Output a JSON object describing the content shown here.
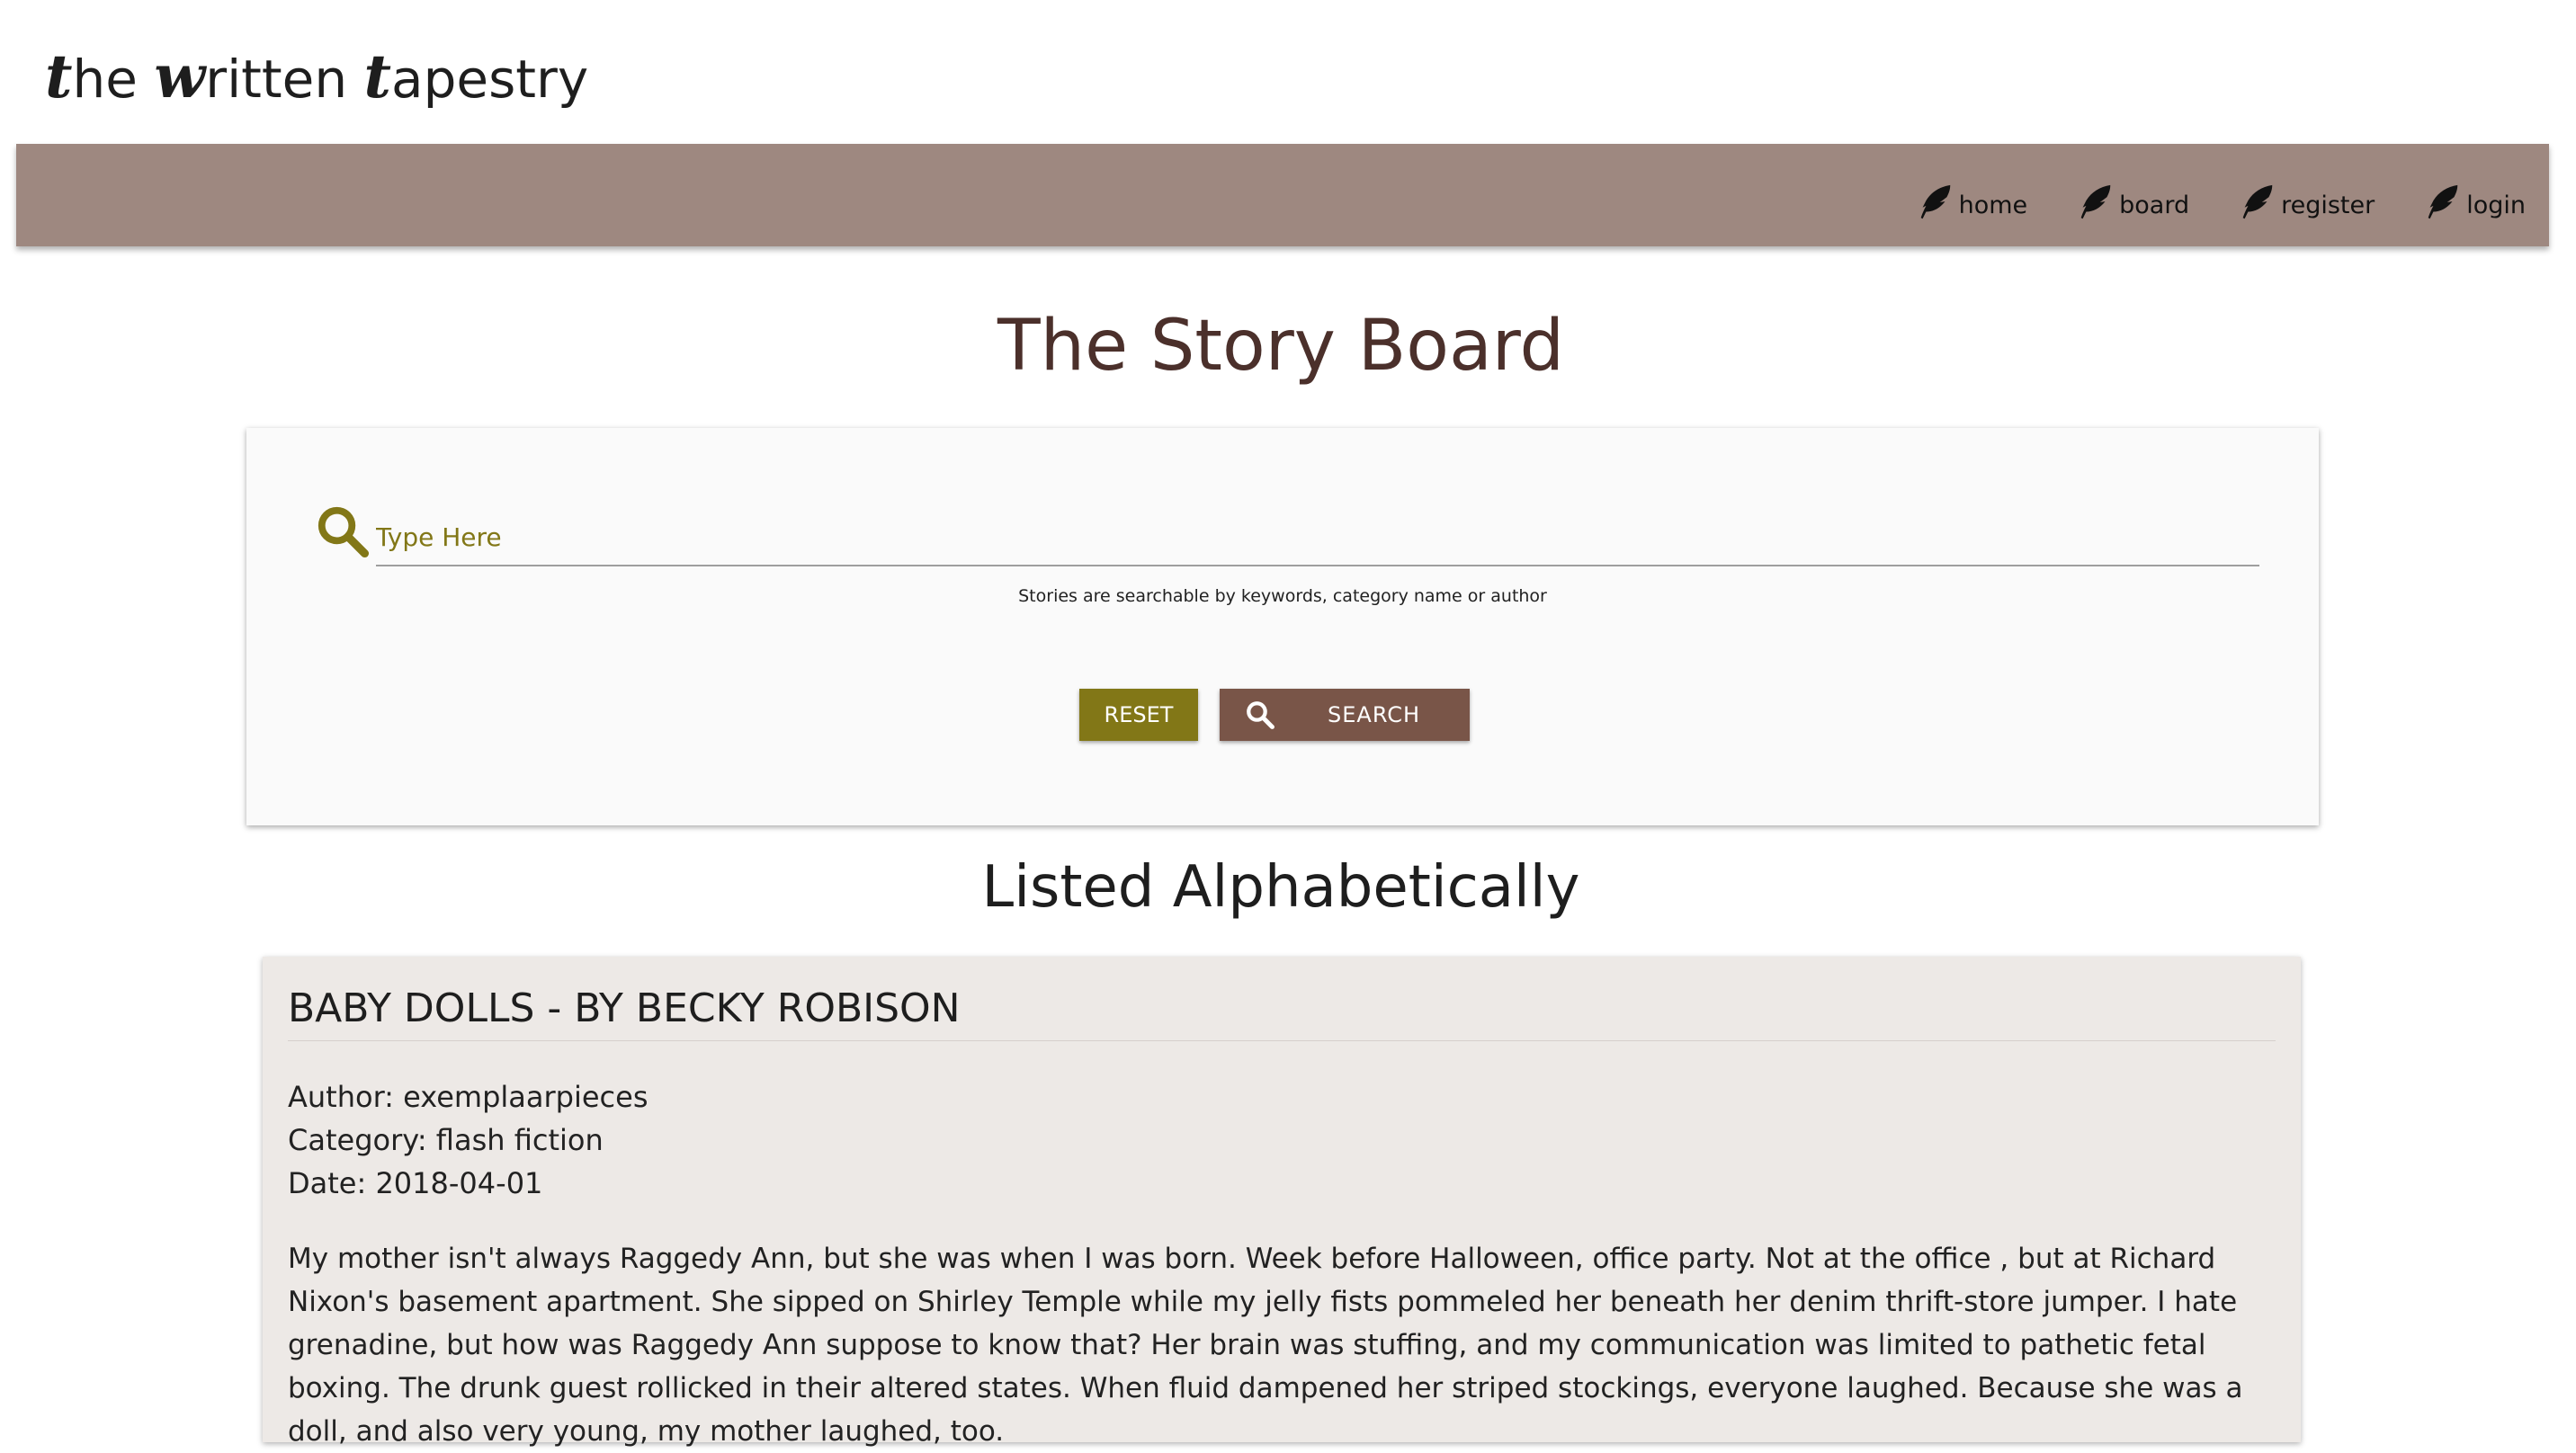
{
  "brand": {
    "part1_cap": "t",
    "part1_rest": "he ",
    "part2_cap": "w",
    "part2_rest": "ritten ",
    "part3_cap": "t",
    "part3_rest": "apestry"
  },
  "nav": {
    "icon": "feather-icon",
    "items": [
      {
        "label": "home"
      },
      {
        "label": "board"
      },
      {
        "label": "register"
      },
      {
        "label": "login"
      }
    ]
  },
  "page": {
    "title": "The Story Board",
    "section_title": "Listed Alphabetically"
  },
  "search": {
    "placeholder": "Type Here",
    "value": "",
    "helper": "Stories are searchable by keywords, category name or author",
    "reset_label": "RESET",
    "search_label": "SEARCH"
  },
  "story": {
    "title": "BABY DOLLS - BY BECKY ROBISON",
    "author": "Author: exemplaarpieces",
    "category": "Category: flash fiction",
    "date": "Date: 2018-04-01",
    "body": "My mother isn't always Raggedy Ann, but she was when I was born. Week before Halloween, office party. Not at the office , but at Richard Nixon's basement apartment. She sipped on Shirley Temple while my jelly fists pommeled her beneath her denim thrift-store jumper. I hate grenadine, but how was Raggedy Ann suppose to know that? Her brain was stuffing, and my communication was limited to pathetic fetal boxing. The drunk guest rollicked in their altered states. When fluid dampened her striped stockings, everyone laughed. Because she was a doll, and also very young, my mother laughed, too."
  },
  "colors": {
    "navbar": "#9e8880",
    "accent_olive": "#827717",
    "accent_brown": "#795548",
    "title_brown": "#4b302b",
    "card_bg": "#ede9e6"
  }
}
